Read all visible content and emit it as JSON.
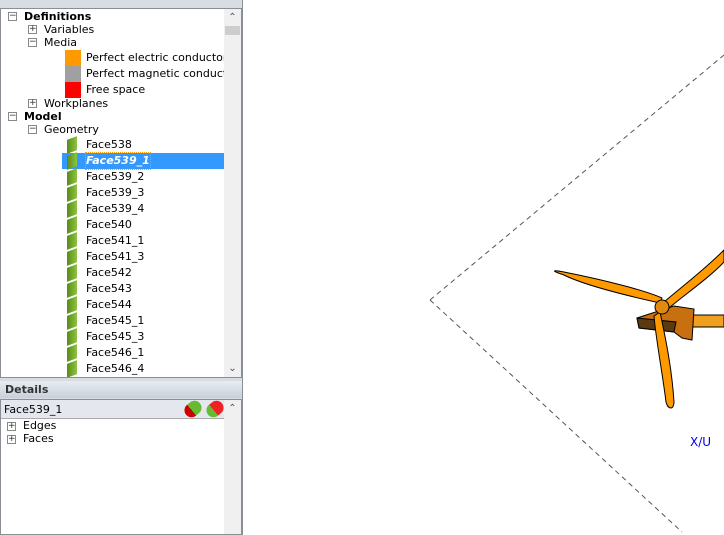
{
  "tree": {
    "definitions": "Definitions",
    "variables": "Variables",
    "media": "Media",
    "media_items": [
      {
        "label": "Perfect electric conductor",
        "color": "#ff9900"
      },
      {
        "label": "Perfect magnetic conductor",
        "color": "#a0a0a0"
      },
      {
        "label": "Free space",
        "color": "#ff0000"
      }
    ],
    "workplanes": "Workplanes",
    "model": "Model",
    "geometry": "Geometry",
    "faces": [
      "Face538",
      "Face539_1",
      "Face539_2",
      "Face539_3",
      "Face539_4",
      "Face540",
      "Face541_1",
      "Face541_3",
      "Face542",
      "Face543",
      "Face544",
      "Face545_1",
      "Face545_3",
      "Face546_1",
      "Face546_4"
    ],
    "selected": "Face539_1"
  },
  "details": {
    "title": "Details",
    "selected_name": "Face539_1",
    "items": [
      "Edges",
      "Faces"
    ]
  },
  "viewport": {
    "axis_label": "X/U",
    "model_color": "#ff9900"
  }
}
